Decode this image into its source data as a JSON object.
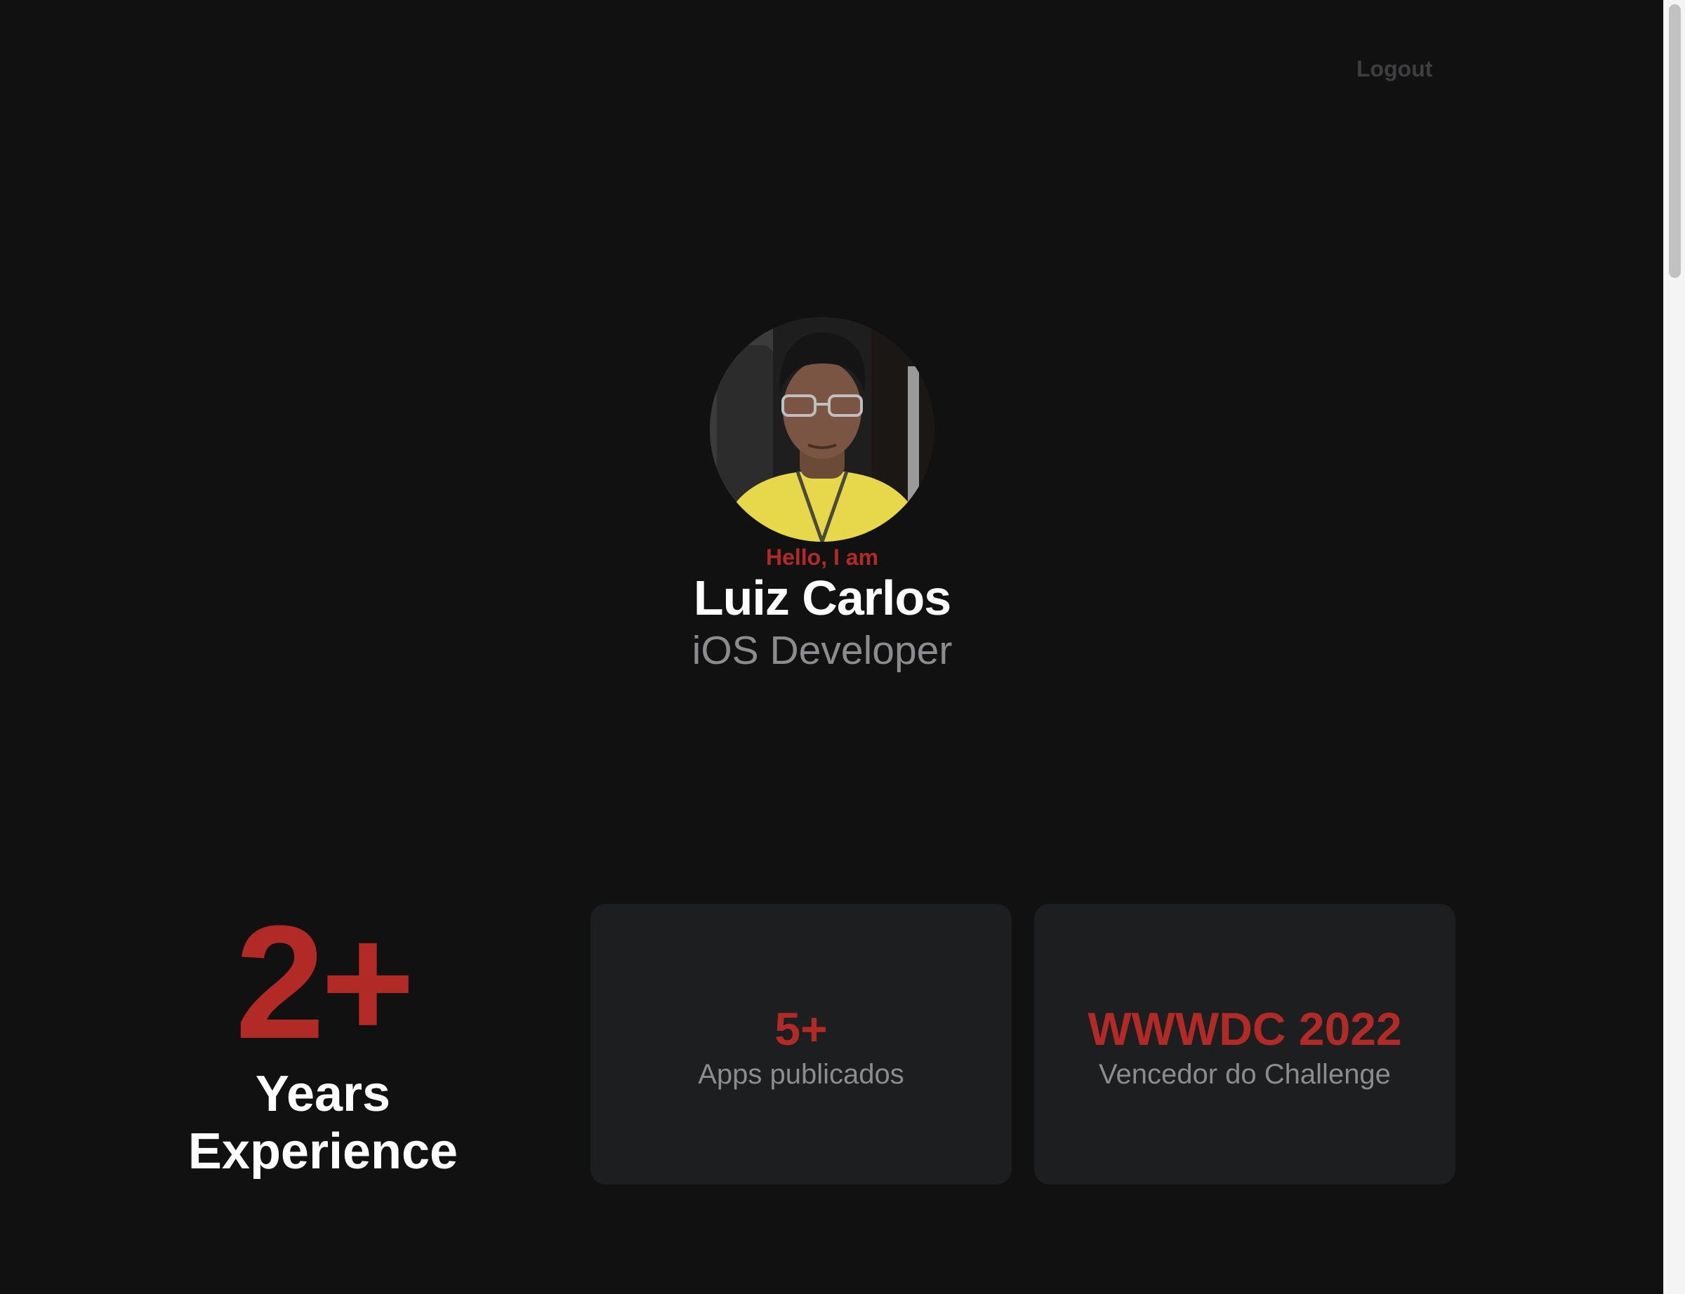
{
  "header": {
    "logout_label": "Logout"
  },
  "profile": {
    "greeting": "Hello, I am",
    "name": "Luiz Carlos",
    "role": "iOS Developer"
  },
  "stats": {
    "experience": {
      "value": "2+",
      "label_line1": "Years",
      "label_line2": "Experience"
    },
    "cards": [
      {
        "value": "5+",
        "label": "Apps publicados"
      },
      {
        "value": "WWWDC 2022",
        "label": "Vencedor do Challenge"
      }
    ]
  },
  "colors": {
    "background": "#111112",
    "accent": "#b22a26",
    "muted_text": "#8c8c8e",
    "card_background": "#1d1e20"
  }
}
